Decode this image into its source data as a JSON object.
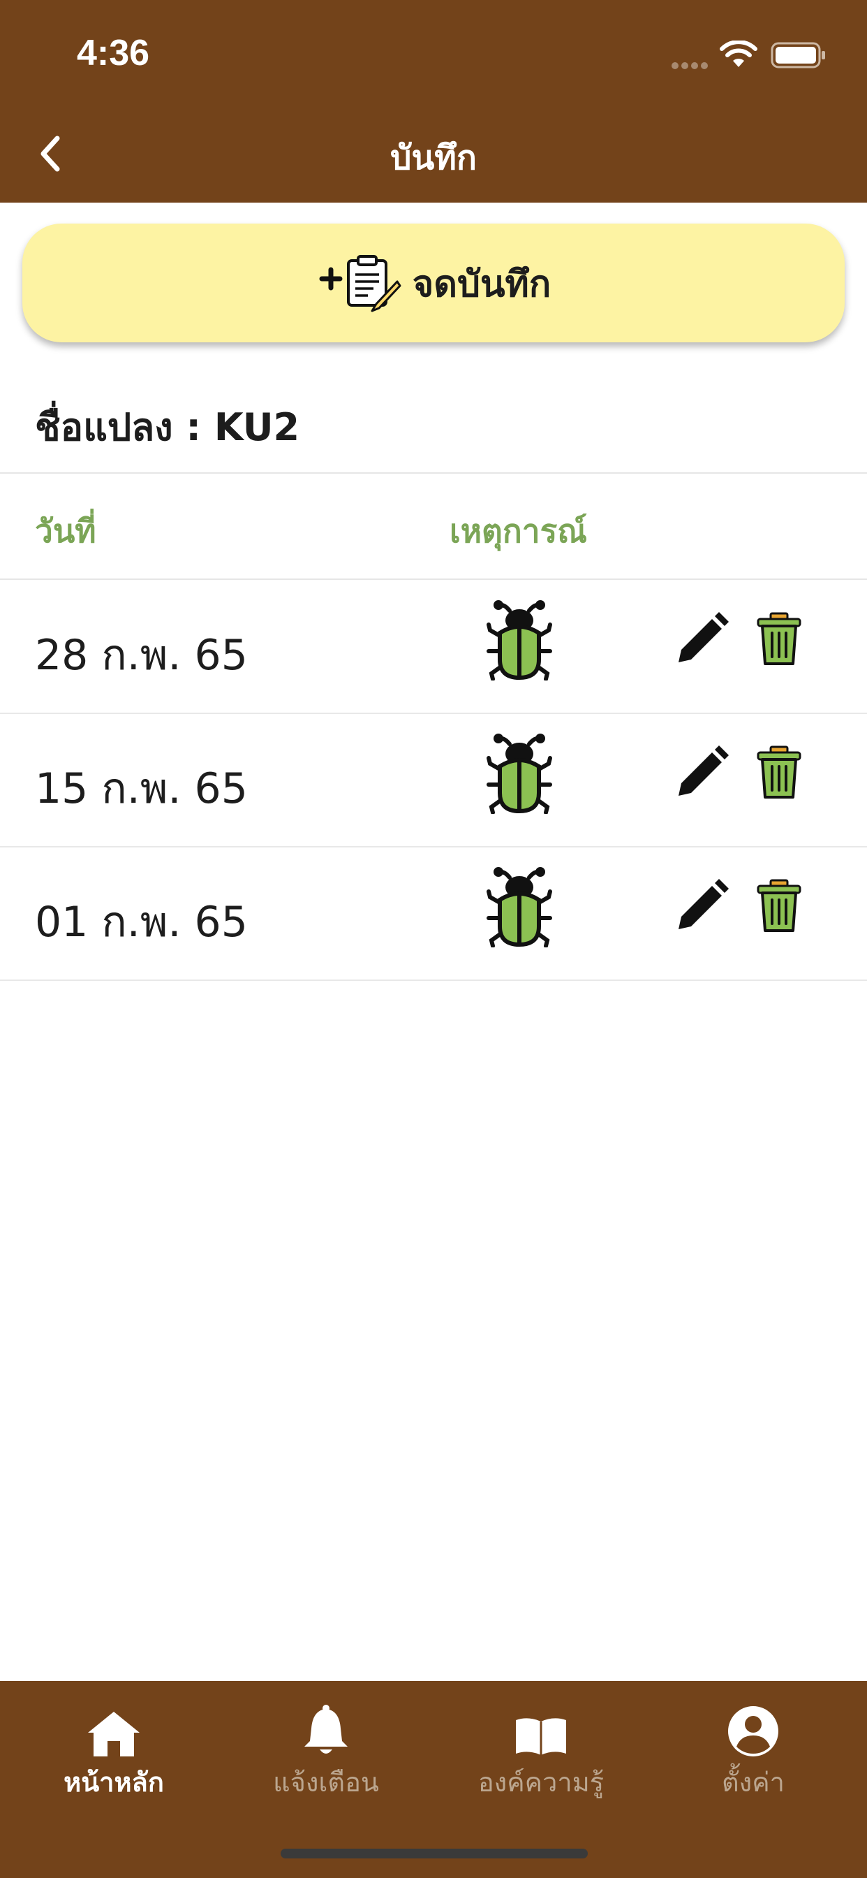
{
  "status": {
    "time": "4:36"
  },
  "navbar": {
    "title": "บันทึก"
  },
  "note_button": {
    "label": "จดบันทึก"
  },
  "plot": {
    "name": "ชื่อแปลง : KU2"
  },
  "table": {
    "headers": {
      "date": "วันที่",
      "event": "เหตุการณ์"
    },
    "rows": [
      {
        "date": "28 ก.พ. 65",
        "event_icon": "bug-icon"
      },
      {
        "date": "15 ก.พ. 65",
        "event_icon": "bug-icon"
      },
      {
        "date": "01 ก.พ. 65",
        "event_icon": "bug-icon"
      }
    ]
  },
  "tabs": [
    {
      "label": "หน้าหลัก",
      "icon": "home-icon",
      "active": true
    },
    {
      "label": "แจ้งเตือน",
      "icon": "bell-icon",
      "active": false
    },
    {
      "label": "องค์ความรู้",
      "icon": "book-icon",
      "active": false
    },
    {
      "label": "ตั้งค่า",
      "icon": "user-icon",
      "active": false
    }
  ],
  "colors": {
    "brand_brown": "#73431a",
    "button_yellow": "#fdf3a3",
    "header_green": "#7ba556",
    "icon_green": "#8cc152"
  }
}
